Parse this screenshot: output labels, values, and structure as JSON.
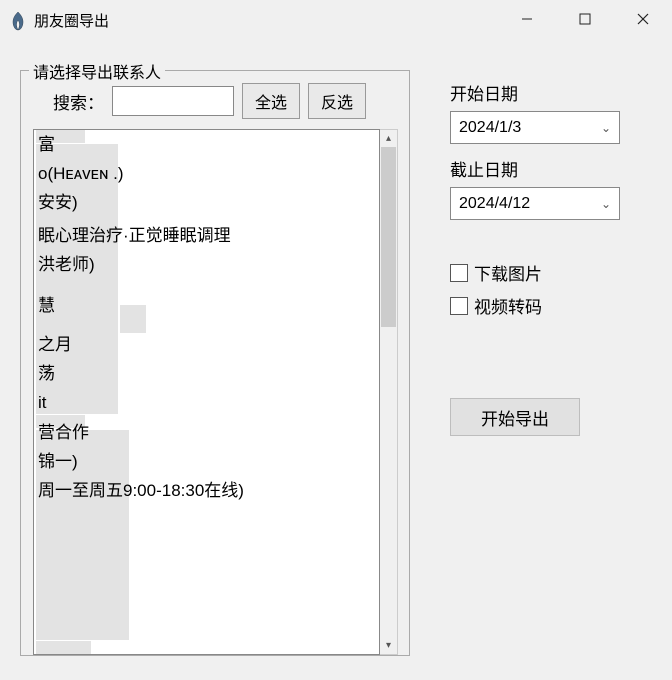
{
  "titlebar": {
    "title": "朋友圈导出"
  },
  "fieldset": {
    "legend": "请选择导出联系人",
    "search_label": "搜索：",
    "search_value": "",
    "select_all": "全选",
    "invert": "反选"
  },
  "contacts": [
    "            富",
    "             o(Hᴇᴀᴠᴇɴ .)",
    "           安安)",
    " ",
    "           眠心理治疗·正觉睡眠调理",
    "           洪老师)",
    " ",
    " ",
    " ",
    " ",
    "           慧",
    " ",
    " ",
    " ",
    "           之月",
    "           荡",
    "             it",
    "           营合作",
    "           锦一)",
    "           周一至周五9:00-18:30在线)"
  ],
  "right": {
    "start_label": "开始日期",
    "start_value": "2024/1/3",
    "end_label": "截止日期",
    "end_value": "2024/4/12",
    "download_images": "下载图片",
    "video_transcode": "视频转码",
    "export_button": "开始导出"
  }
}
